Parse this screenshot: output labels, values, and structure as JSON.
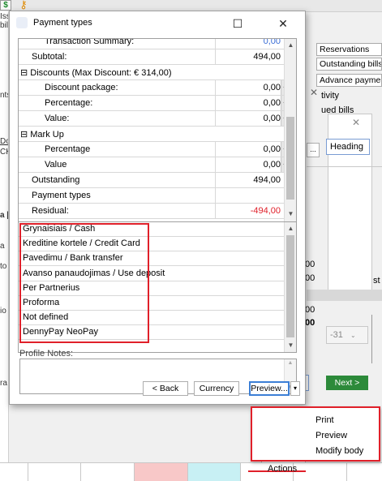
{
  "background": {
    "left_fragments": [
      "Issu",
      "bil",
      "nts",
      "Doc",
      "ČK",
      "a [",
      "a",
      "to",
      "io",
      "ra"
    ],
    "right_buttons": [
      "Reservations",
      "Outstanding bills",
      "Advance paymen"
    ],
    "right_fragments": {
      "activity": "tivity",
      "unpaid_bills": "ued bills",
      "heading": "Heading",
      "next": "Next >",
      "date_suffix": "-31",
      "actions": "Actions",
      "amount_a": "00",
      "amount_b": "00",
      "amount_c": "00",
      "amount_d": "00",
      "ellipsis": "...",
      "st": "st"
    }
  },
  "dialog": {
    "title": "Payment types",
    "minimize_icon": "☐",
    "close_icon": "✕",
    "totals": [
      {
        "label": "Transaction Summary:",
        "value": "0,00",
        "indent": 2,
        "partial": true
      },
      {
        "label": "Subtotal:",
        "value": "494,00",
        "indent": 1
      },
      {
        "label": "⊟ Discounts (Max Discount: € 314,00)",
        "value": "",
        "indent": 0,
        "section": true
      },
      {
        "label": "Discount package:",
        "value": "0,00",
        "indent": 2,
        "dots": true
      },
      {
        "label": "Percentage:",
        "value": "0,00",
        "indent": 2,
        "dots": true
      },
      {
        "label": "Value:",
        "value": "0,00",
        "indent": 2,
        "dots": true
      },
      {
        "label": "⊟ Mark Up",
        "value": "",
        "indent": 0,
        "section": true
      },
      {
        "label": "Percentage",
        "value": "0,00",
        "indent": 2,
        "dots": true
      },
      {
        "label": "Value",
        "value": "0,00",
        "indent": 2,
        "dots": true
      },
      {
        "label": "Outstanding",
        "value": "494,00",
        "indent": 1
      },
      {
        "label": "Payment types",
        "value": "",
        "indent": 1
      },
      {
        "label": "Residual:",
        "value": "-494,00",
        "indent": 1,
        "negative": true
      }
    ],
    "payment_types": [
      "Grynaisiais / Cash",
      "Kreditine kortele / Credit Card",
      "Pavedimu / Bank transfer",
      "Avanso panaudojimas / Use deposit",
      "Per Partnerius",
      "Proforma",
      "Not defined",
      "DennyPay NeoPay"
    ],
    "profile_notes_label": "Profile Notes:",
    "profile_notes_value": "",
    "buttons": {
      "back": "< Back",
      "currency": "Currency",
      "preview": "Preview..."
    }
  },
  "context_menu": {
    "items": [
      "Print",
      "Preview",
      "Modify body"
    ]
  },
  "colors": {
    "highlight": "#e0202a",
    "negative": "#e0202a",
    "accent_pink": "#f8c8c8",
    "accent_cyan": "#c8f0f4"
  }
}
